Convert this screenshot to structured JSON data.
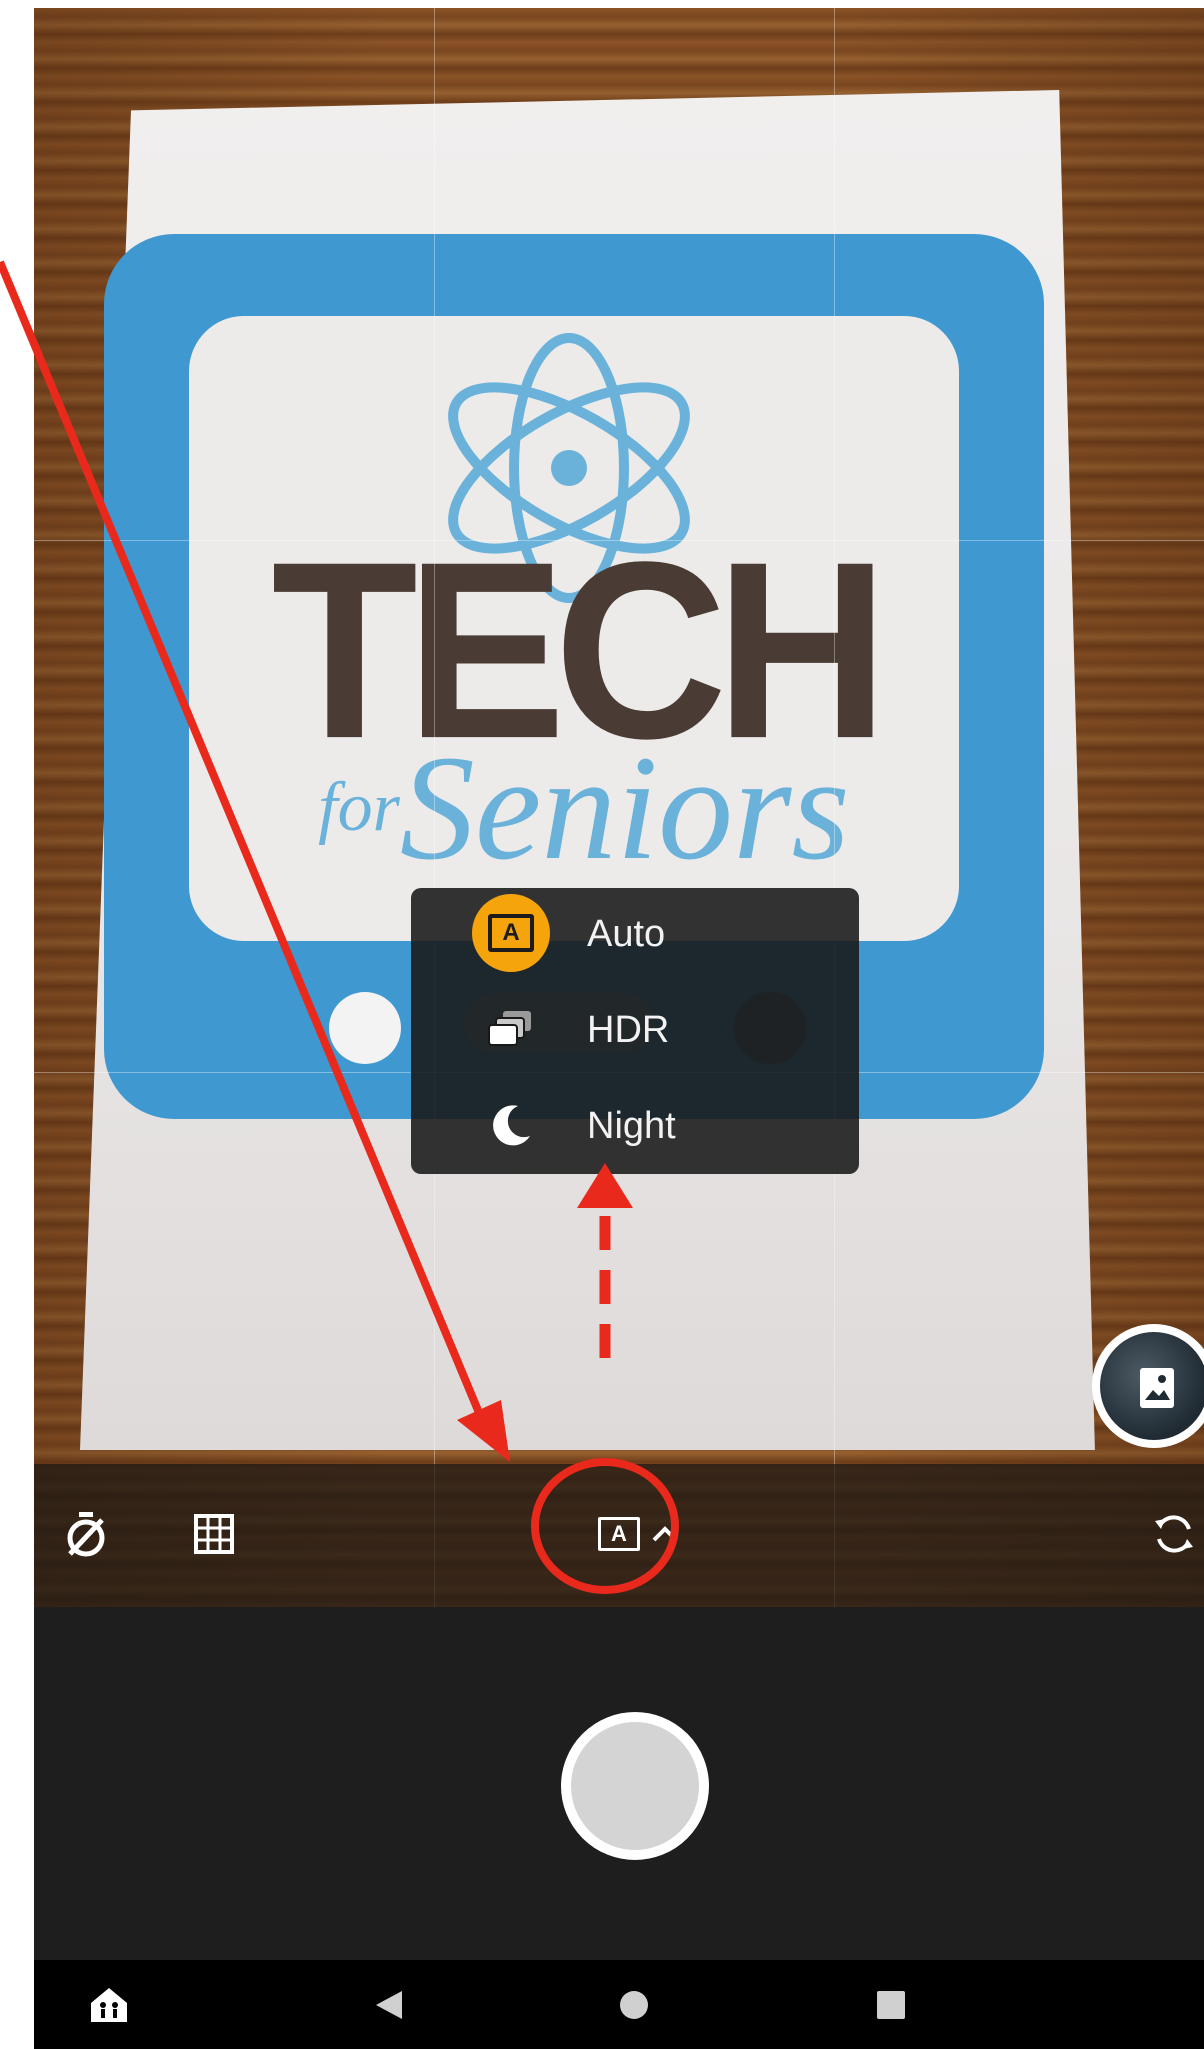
{
  "viewfinder": {
    "scene_text": {
      "tech": "TECH",
      "for": "for",
      "seniors": "Seniors"
    }
  },
  "mode_menu": {
    "items": [
      {
        "label": "Auto",
        "icon": "auto-mode-icon",
        "selected": true
      },
      {
        "label": "HDR",
        "icon": "hdr-icon",
        "selected": false
      },
      {
        "label": "Night",
        "icon": "moon-icon",
        "selected": false
      }
    ]
  },
  "toolbar": {
    "timer_icon": "timer-off-icon",
    "grid_icon": "grid-icon",
    "mode_icon_letter": "A",
    "mode_chevron": "chevron-up-icon",
    "switch_icon": "switch-camera-icon"
  },
  "colors": {
    "accent": "#f5a40c",
    "annotation": "#e8291c",
    "menu_bg": "#181818",
    "bottom_bg": "#1e1e1e"
  },
  "navbar": {
    "icons": [
      "accessibility-home-icon",
      "back-icon",
      "home-icon",
      "recents-icon"
    ]
  }
}
